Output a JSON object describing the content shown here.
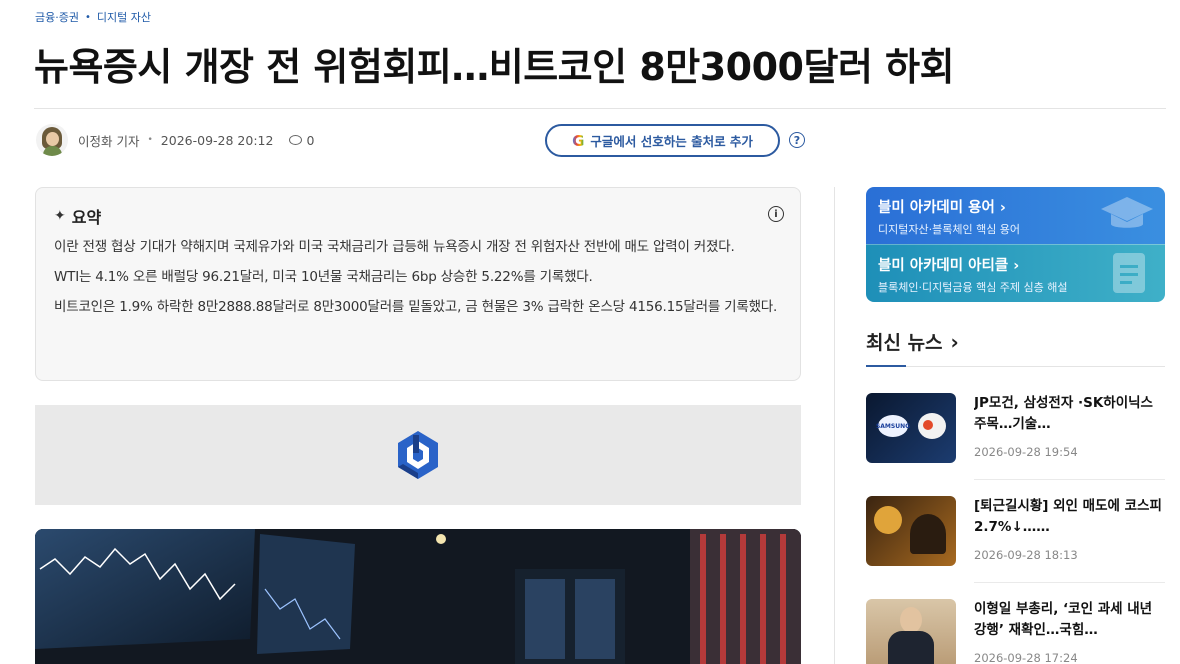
{
  "breadcrumb": {
    "section": "금융·증권",
    "subsection": "디지털 자산"
  },
  "article": {
    "headline": "뉴욕증시 개장 전 위험회피…비트코인 8만3000달러 하회",
    "author": "이정화 기자",
    "datetime": "2026-09-28 20:12",
    "comment_count": "0"
  },
  "google_button": {
    "icon": "G",
    "label": "구글에서 선호하는 출처로 추가"
  },
  "summary": {
    "title": "요약",
    "paragraphs": [
      "이란 전쟁 협상 기대가 약해지며 국제유가와 미국 국채금리가 급등해 뉴욕증시 개장 전 위험자산 전반에 매도 압력이 커졌다.",
      "WTI는 4.1% 오른 배럴당 96.21달러, 미국 10년물 국채금리는 6bp 상승한 5.22%를 기록했다.",
      "비트코인은 1.9% 하락한 8만2888.88달러로 8만3000달러를 밑돌았고, 금 현물은 3% 급락한 온스당 4156.15달러를 기록했다."
    ]
  },
  "sidebar": {
    "academy": [
      {
        "title": "블미 아카데미 용어 ›",
        "subtitle": "디지털자산·블록체인 핵심 용어"
      },
      {
        "title": "블미 아카데미 아티클 ›",
        "subtitle": "블록체인·디지털금융 핵심 주제 심층 해설"
      }
    ],
    "latest_title": "최신 뉴스",
    "latest_news": [
      {
        "title": "JP모건, 삼성전자 ·SK하이닉스 주목…기술…",
        "date": "2026-09-28 19:54"
      },
      {
        "title": "[퇴근길시황] 외인 매도에 코스피 2.7%↓……",
        "date": "2026-09-28 18:13"
      },
      {
        "title": "이형일 부총리, ‘코인 과세 내년 강행’ 재확인…국힘…",
        "date": "2026-09-28 17:24"
      }
    ]
  },
  "colors": {
    "accent": "#2c5aa0",
    "link": "#1f5aa8"
  }
}
